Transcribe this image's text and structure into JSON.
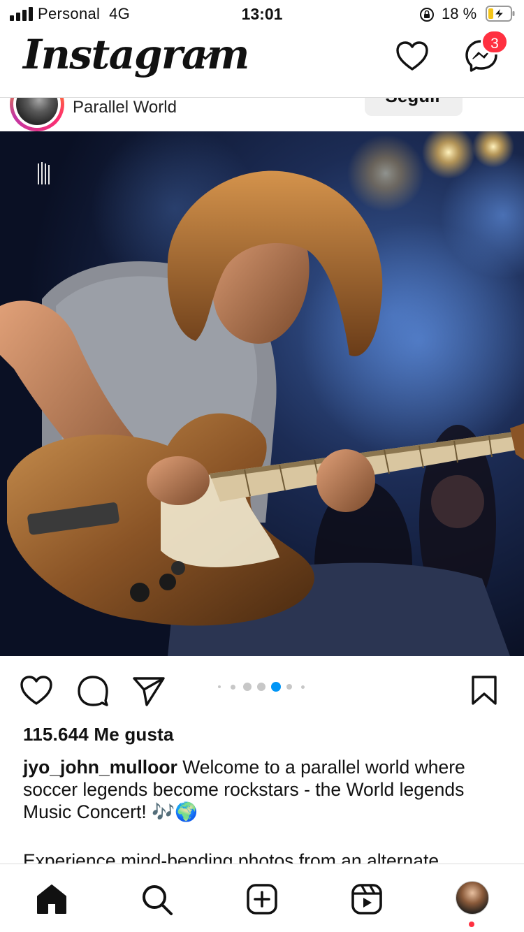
{
  "status_bar": {
    "carrier": "Personal",
    "network": "4G",
    "time": "13:01",
    "battery": "18 %"
  },
  "header": {
    "logo": "Instagram",
    "notifications_badge": "3"
  },
  "post": {
    "location": "Parallel World",
    "follow_label": "Seguir",
    "likes": "115.644 Me gusta",
    "username": "jyo_john_mulloor",
    "caption": " Welcome to a parallel world where soccer legends become rockstars - the World legends Music Concert! 🎶🌍",
    "caption_more": "Experience mind-bending photos from an alternate",
    "carousel": {
      "total": 7,
      "active_index": 4
    }
  },
  "colors": {
    "badge": "#ff3040",
    "active_dot": "#0095f6",
    "inactive_dot": "#c7c7c7"
  },
  "icons": {
    "status": [
      "signal-icon",
      "lock-rotation-icon",
      "battery-charging-icon"
    ],
    "header": [
      "chevron-down-icon",
      "heart-icon",
      "messenger-icon"
    ],
    "actions": [
      "like-icon",
      "comment-icon",
      "share-icon",
      "save-icon"
    ],
    "nav": [
      "home-icon",
      "search-icon",
      "new-post-icon",
      "reels-icon",
      "profile-avatar"
    ]
  }
}
